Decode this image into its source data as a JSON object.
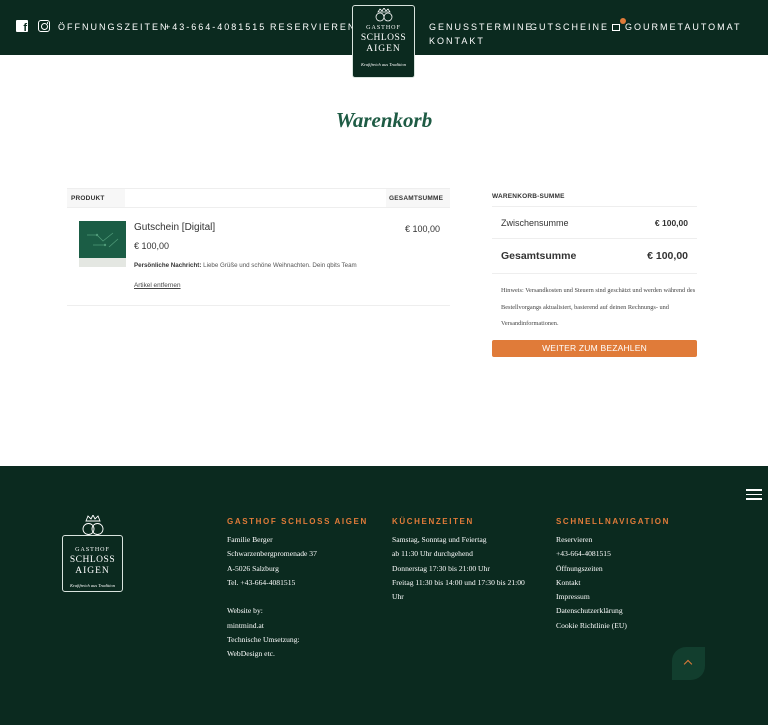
{
  "header": {
    "nav_left": [
      "ÖFFNUNGSZEITEN",
      "+43-664-4081515",
      "RESERVIEREN"
    ],
    "nav_right": [
      "GENUSSTERMINE",
      "GUTSCHEINE",
      "GOURMETAUTOMAT",
      "KONTAKT"
    ],
    "logo": {
      "line1": "GASTHOF",
      "line2": "SCHLOSS",
      "line3": "AIGEN",
      "tagline": "Kraftfreich aus Tradition"
    },
    "social_icons": [
      "facebook-icon",
      "instagram-icon"
    ]
  },
  "page": {
    "title": "Warenkorb"
  },
  "cart": {
    "col_product": "PRODUKT",
    "col_total": "GESAMTSUMME",
    "item": {
      "name": "Gutschein [Digital]",
      "price": "€ 100,00",
      "message_label": "Persönliche Nachricht:",
      "message_text": "Liebe Grüße und schöne Weihnachten. Dein qbits Team",
      "remove": "Artikel entfernen",
      "total": "€ 100,00"
    }
  },
  "summary": {
    "title": "WARENKORB-SUMME",
    "subtotal_label": "Zwischensumme",
    "subtotal_value": "€ 100,00",
    "total_label": "Gesamtsumme",
    "total_value": "€ 100,00",
    "note": "Hinweis: Versandkosten und Steuern sind geschätzt und werden während des Bestellvorgangs aktualisiert, basierend auf deinen Rechnungs- und Versandinformationen.",
    "checkout": "WEITER ZUM BEZAHLEN"
  },
  "footer": {
    "col1": {
      "heading": "GASTHOF SCHLOSS AIGEN",
      "lines": [
        "Familie Berger",
        "Schwarzenbergpromenade 37",
        "A-5026 Salzburg",
        "Tel. +43-664-4081515"
      ],
      "credits": [
        "Website by:",
        "mintmind.at",
        "Technische Umsetzung:",
        "WebDesign etc."
      ]
    },
    "col2": {
      "heading": "KÜCHENZEITEN",
      "lines": [
        "Samstag, Sonntag und Feiertag",
        "ab 11:30 Uhr durchgehend",
        "Donnerstag 17:30 bis 21:00 Uhr",
        "Freitag 11:30 bis 14:00 und 17:30 bis 21:00",
        "Uhr"
      ]
    },
    "col3": {
      "heading": "SCHNELLNAVIGATION",
      "links": [
        "Reservieren",
        "+43-664-4081515",
        "Öffnungszeiten",
        "Kontakt",
        "Impressum",
        "Datenschutzerklärung",
        "Cookie Richtlinie (EU)"
      ]
    }
  },
  "colors": {
    "dark_green": "#0b2a1f",
    "accent_orange": "#e07b39",
    "title_green": "#1e5b44"
  }
}
